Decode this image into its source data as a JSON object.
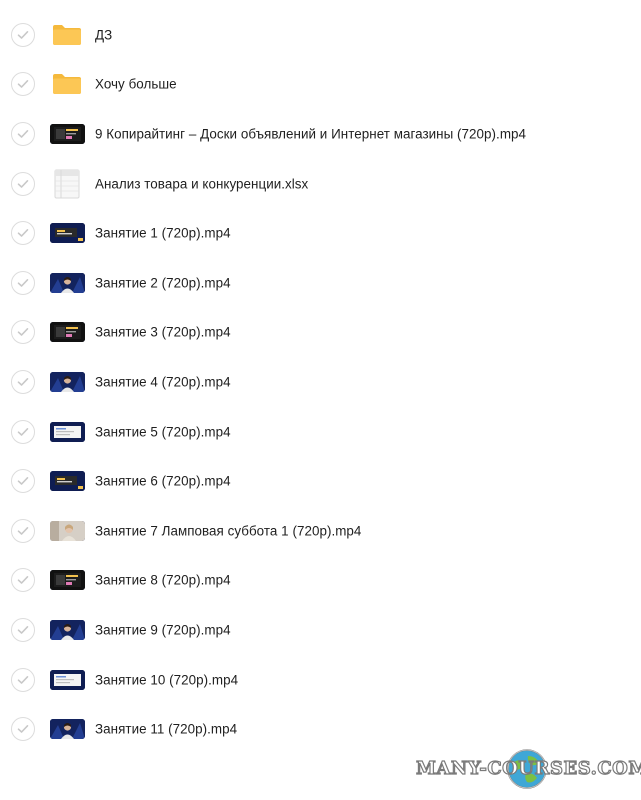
{
  "files": [
    {
      "name": "ДЗ",
      "type": "folder"
    },
    {
      "name": "Хочу больше",
      "type": "folder"
    },
    {
      "name": "9 Копирайтинг – Доски объявлений и Интернет магазины (720p).mp4",
      "type": "video-dark"
    },
    {
      "name": "Анализ товара и конкуренции.xlsx",
      "type": "spreadsheet"
    },
    {
      "name": "Занятие 1 (720p).mp4",
      "type": "video-slide"
    },
    {
      "name": "Занятие 2 (720p).mp4",
      "type": "video-person"
    },
    {
      "name": "Занятие 3 (720p).mp4",
      "type": "video-dark"
    },
    {
      "name": "Занятие 4 (720p).mp4",
      "type": "video-person"
    },
    {
      "name": "Занятие 5 (720p).mp4",
      "type": "video-screen"
    },
    {
      "name": "Занятие 6 (720p).mp4",
      "type": "video-slide"
    },
    {
      "name": "Занятие 7 Ламповая суббота 1 (720p).mp4",
      "type": "video-lamp"
    },
    {
      "name": "Занятие 8 (720p).mp4",
      "type": "video-dark"
    },
    {
      "name": "Занятие 9 (720p).mp4",
      "type": "video-person"
    },
    {
      "name": "Занятие 10 (720p).mp4",
      "type": "video-screen"
    },
    {
      "name": "Занятие 11 (720p).mp4",
      "type": "video-person"
    }
  ],
  "icons": {
    "checkbox": "check-circle-icon",
    "folder": "folder-icon",
    "spreadsheet": "spreadsheet-icon",
    "video": "video-thumbnail-icon"
  },
  "colors": {
    "folder": "#fcc755",
    "folder_tab": "#f5b93c",
    "check_border": "#dcdcdc",
    "check_mark": "#c8c8c8",
    "video_bg": "#0e1a4a",
    "text": "#1f1f1f"
  },
  "watermark": {
    "text": "MANY-COURSES.COM"
  }
}
